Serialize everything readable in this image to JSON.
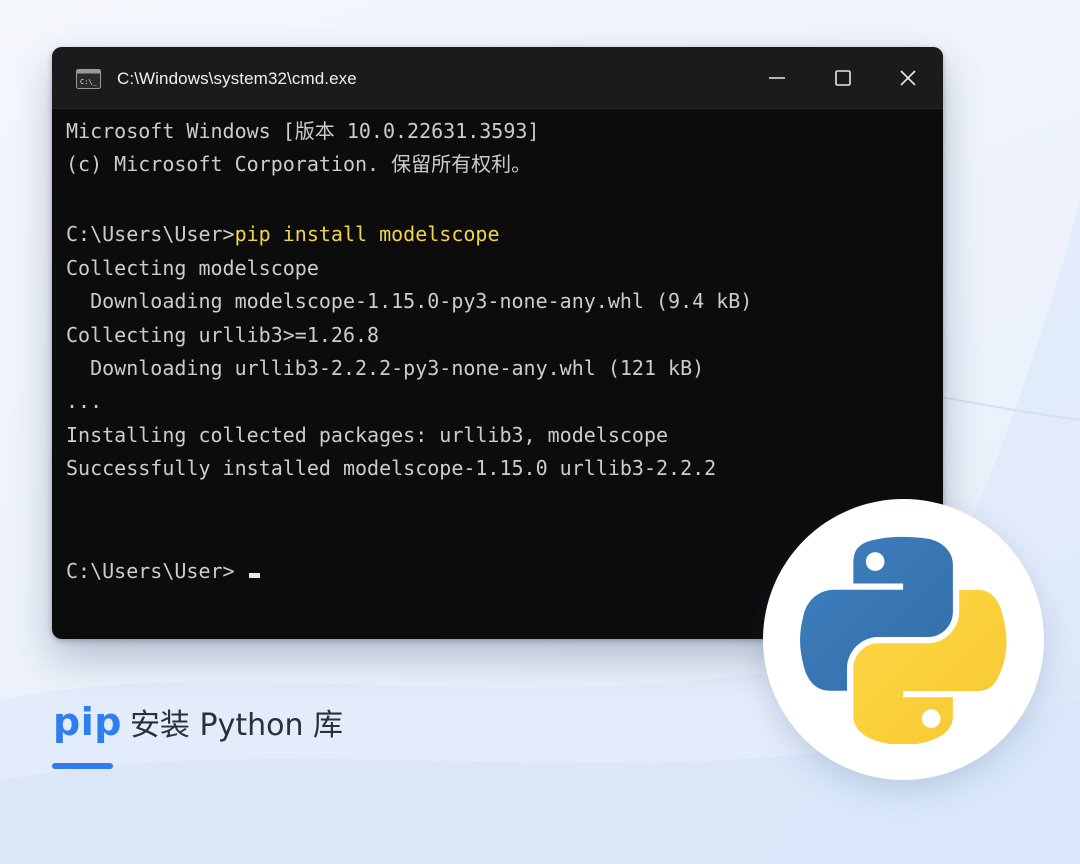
{
  "window": {
    "title": "C:\\Windows\\system32\\cmd.exe",
    "icon": "cmd-icon"
  },
  "console": {
    "lines": [
      {
        "text": "Microsoft Windows [版本 10.0.22631.3593]"
      },
      {
        "text": "(c) Microsoft Corporation. 保留所有权利。"
      },
      {
        "text": ""
      },
      {
        "prompt": "C:\\Users\\User>",
        "command": "pip install modelscope"
      },
      {
        "text": "Collecting modelscope"
      },
      {
        "text": "  Downloading modelscope-1.15.0-py3-none-any.whl (9.4 kB)"
      },
      {
        "text": "Collecting urllib3>=1.26.8"
      },
      {
        "text": "  Downloading urllib3-2.2.2-py3-none-any.whl (121 kB)"
      },
      {
        "text": "..."
      },
      {
        "text": "Installing collected packages: urllib3, modelscope"
      },
      {
        "text": "Successfully installed modelscope-1.15.0 urllib3-2.2.2"
      },
      {
        "text": ""
      },
      {
        "text": ""
      },
      {
        "prompt": "C:\\Users\\User> "
      }
    ]
  },
  "caption": {
    "highlight": "pip",
    "rest": "安装 Python 库"
  },
  "colors": {
    "accent": "#2f7df0",
    "command": "#f1d542",
    "python_blue": "#3776ab",
    "python_yellow": "#ffd43b"
  },
  "logo": {
    "icon": "python-logo-icon"
  }
}
